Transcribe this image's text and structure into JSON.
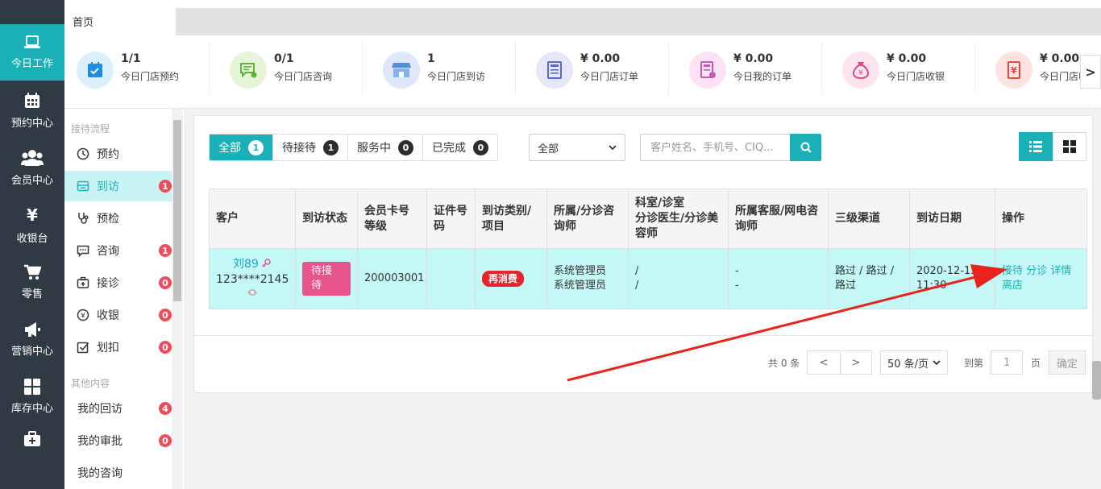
{
  "nav": {
    "items": [
      {
        "label": "今日工作",
        "icon": "laptop-icon",
        "active": true
      },
      {
        "label": "预约中心",
        "icon": "calendar-icon",
        "active": false
      },
      {
        "label": "会员中心",
        "icon": "users-icon",
        "active": false
      },
      {
        "label": "收银台",
        "icon": "yen-icon",
        "active": false
      },
      {
        "label": "零售",
        "icon": "cart-icon",
        "active": false
      },
      {
        "label": "营销中心",
        "icon": "megaphone-icon",
        "active": false
      },
      {
        "label": "库存中心",
        "icon": "grid-icon",
        "active": false
      },
      {
        "label": "",
        "icon": "medkit-icon",
        "active": false
      }
    ],
    "active_color": "#1ab0b8"
  },
  "tabs": [
    {
      "label": "首页"
    }
  ],
  "stats": [
    {
      "value": "1/1",
      "label": "今日门店预约",
      "icon": "calendar-check-icon",
      "color": "#dbeffc"
    },
    {
      "value": "0/1",
      "label": "今日门店咨询",
      "icon": "chat-icon",
      "color": "#e6f5d8"
    },
    {
      "value": "1",
      "label": "今日门店到访",
      "icon": "store-icon",
      "color": "#dde9fb"
    },
    {
      "value": "¥ 0.00",
      "label": "今日门店订单",
      "icon": "order-icon",
      "color": "#e6e8fa"
    },
    {
      "value": "¥ 0.00",
      "label": "今日我的订单",
      "icon": "my-order-icon",
      "color": "#fbe3f5"
    },
    {
      "value": "¥ 0.00",
      "label": "今日门店收银",
      "icon": "money-bag-icon",
      "color": "#fde4ee"
    },
    {
      "value": "¥ 0.00",
      "label": "今日门店收银",
      "icon": "receipt-icon",
      "color": "#fde2e2"
    }
  ],
  "stats_next": ">",
  "sidemenu": {
    "group1": "接待流程",
    "items1": [
      {
        "label": "预约",
        "icon": "clock-icon",
        "badge": ""
      },
      {
        "label": "到访",
        "icon": "visit-icon",
        "badge": "1",
        "active": true
      },
      {
        "label": "预检",
        "icon": "stethoscope-icon",
        "badge": ""
      },
      {
        "label": "咨询",
        "icon": "consult-icon",
        "badge": "1"
      },
      {
        "label": "接诊",
        "icon": "treatment-icon",
        "badge": "0"
      },
      {
        "label": "收银",
        "icon": "cashier-icon",
        "badge": "0"
      },
      {
        "label": "划扣",
        "icon": "deduct-icon",
        "badge": "0"
      }
    ],
    "group2": "其他内容",
    "items2": [
      {
        "label": "我的回访",
        "badge": "4"
      },
      {
        "label": "我的审批",
        "badge": "0"
      },
      {
        "label": "我的咨询",
        "badge": ""
      }
    ]
  },
  "filters": {
    "segments": [
      {
        "label": "全部",
        "count": "1",
        "on": true
      },
      {
        "label": "待接待",
        "count": "1",
        "on": false
      },
      {
        "label": "服务中",
        "count": "0",
        "on": false
      },
      {
        "label": "已完成",
        "count": "0",
        "on": false
      }
    ],
    "select_value": "全部",
    "search_placeholder": "客户姓名、手机号、CIQ..."
  },
  "table": {
    "headers": [
      "客户",
      "到访状态",
      "会员卡号\n等级",
      "证件号\n码",
      "到访类别/\n项目",
      "所属/分诊咨\n询师",
      "科室/诊室\n分诊医生/分诊美\n容师",
      "所属客服/网电咨\n询师",
      "三级渠道",
      "到访日期",
      "操作"
    ],
    "rows": [
      {
        "customer_name": "刘89",
        "customer_phone": "123****2145",
        "status": "待接待",
        "card_no": "200003001",
        "id_no": "",
        "visit_type": "再消费",
        "consultant_1": "系统管理员",
        "consultant_2": "系统管理员",
        "dept_1": "/",
        "dept_2": "/",
        "service_1": "-",
        "service_2": "-",
        "channel_1": "路过 / 路过 /",
        "channel_2": "路过",
        "date_1": "2020-12-15",
        "date_2": "11:30",
        "ops": [
          "接待",
          "分诊",
          "详情",
          "离店"
        ]
      }
    ]
  },
  "pager": {
    "total": "共 0 条",
    "prev": "<",
    "next": ">",
    "page_size": "50 条/页",
    "goto_label": "到第",
    "goto_value": "1",
    "page_unit": "页",
    "confirm": "确定"
  },
  "annotation": {
    "color": "#e8241c"
  }
}
